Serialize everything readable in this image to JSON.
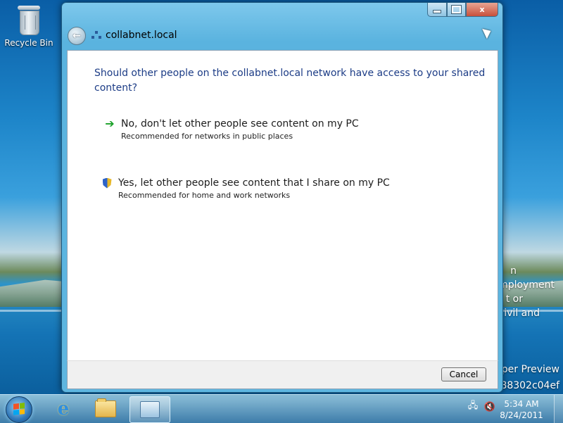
{
  "desktop": {
    "recycle_bin_label": "Recycle Bin",
    "background_text": [
      "n",
      "mployment",
      "t or",
      "ivil and",
      "oper Preview",
      "88302c04ef"
    ]
  },
  "window": {
    "title": "collabnet.local",
    "question": "Should other people on the collabnet.local network have access to your shared content?",
    "options": [
      {
        "icon": "green-arrow-icon",
        "title": "No, don't let other people see content on my PC",
        "subtitle": "Recommended for networks in public places"
      },
      {
        "icon": "uac-shield-icon",
        "title": "Yes, let other people see content that I share on my PC",
        "subtitle": "Recommended for home and work networks"
      }
    ],
    "cancel_label": "Cancel",
    "controls": {
      "minimize": "minimize",
      "maximize": "maximize",
      "close": "x"
    }
  },
  "taskbar": {
    "items": [
      "start-button",
      "internet-explorer",
      "windows-explorer",
      "control-panel"
    ],
    "active_item": "control-panel",
    "clock_time": "5:34 AM",
    "clock_date": "8/24/2011"
  },
  "colors": {
    "question_text": "#1c3c86",
    "arrow_green": "#1aa028"
  }
}
